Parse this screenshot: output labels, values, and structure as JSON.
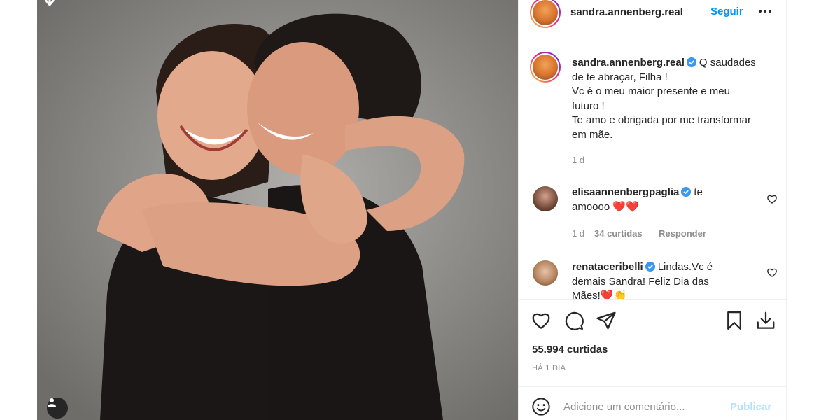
{
  "post": {
    "username": "sandra.annenberg.real",
    "follow_label": "Seguir",
    "more_icon": "more-horizontal-icon",
    "caption": {
      "username": "sandra.annenberg.real",
      "text_line1": "Q saudades",
      "text_rest": "de te abraçar, Filha !",
      "line3": "Vc é o meu maior presente e meu",
      "line4": "futuro !",
      "line5": "Te amo e obrigada por me transformar",
      "line6": "em mãe.",
      "time": "1 d"
    },
    "comments": [
      {
        "username": "elisaannenbergpaglia",
        "text": "te",
        "text_cont": "amoooo ❤️❤️",
        "time": "1 d",
        "likes": "34 curtidas",
        "reply": "Responder"
      },
      {
        "username": "renataceribelli",
        "text": "Lindas.Vc é",
        "text_cont": "demais Sandra! Feliz Dia das",
        "text_cont2": "Mães!❤️👏"
      }
    ],
    "likes_label": "55.994 curtidas",
    "date_label": "HÁ 1 DIA",
    "comment_placeholder": "Adicione um comentário...",
    "publish_label": "Publicar"
  },
  "colors": {
    "link_blue": "#0095f6",
    "verified_blue": "#3897f0",
    "publish_disabled": "#b2dffc",
    "muted": "#8e8e8e"
  },
  "icons": {
    "like": "heart-outline-icon",
    "comment": "comment-bubble-icon",
    "share": "paper-plane-icon",
    "save": "bookmark-icon",
    "download": "download-icon",
    "emoji": "smiley-icon",
    "user_tag": "user-tag-icon",
    "verified": "verified-badge-icon"
  }
}
